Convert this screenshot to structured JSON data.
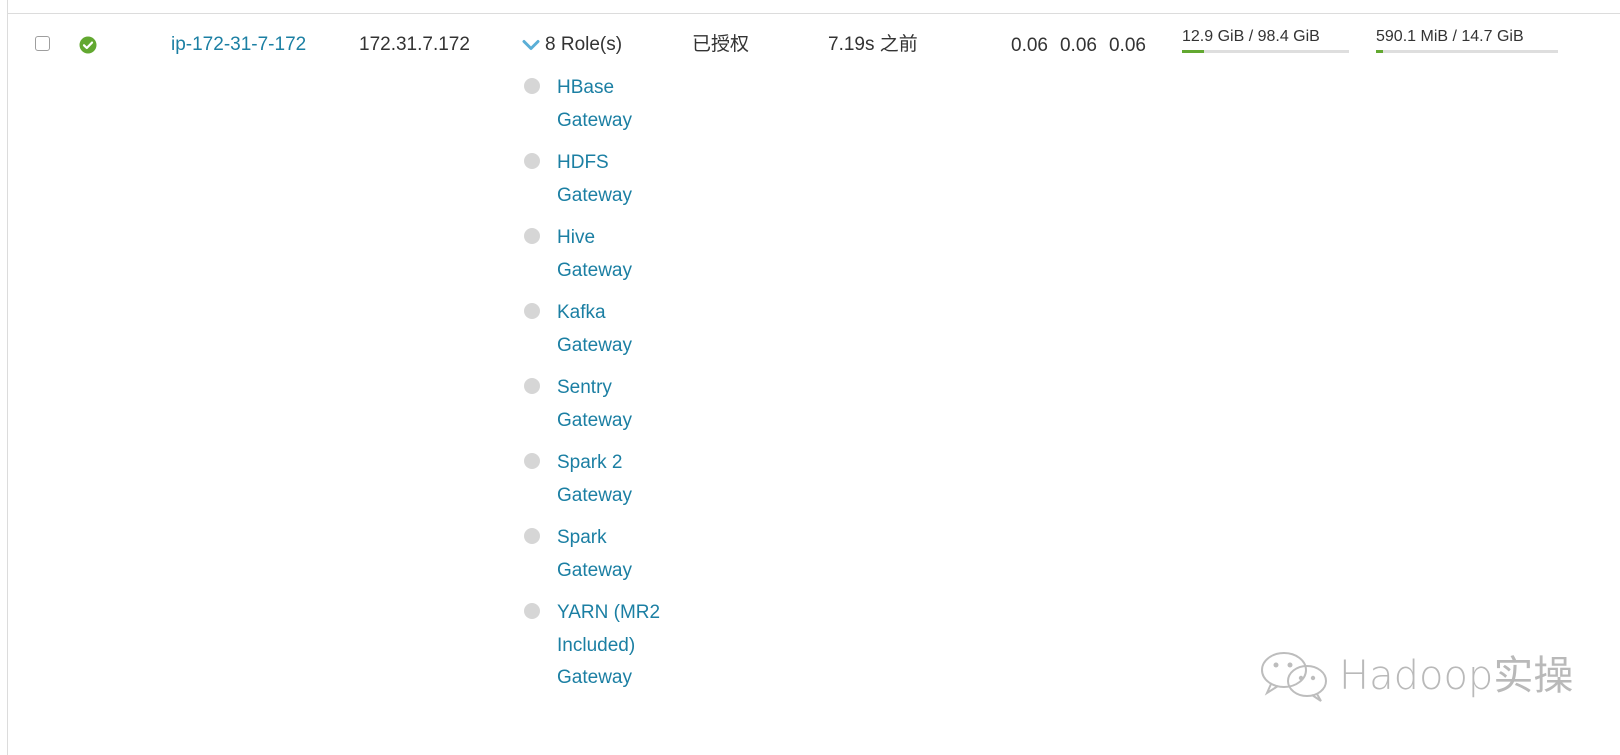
{
  "host_row": {
    "hostname": "ip-172-31-7-172",
    "ip_address": "172.31.7.172",
    "roles_toggle_label": "8 Role(s)",
    "commission_state": "已授权",
    "last_heartbeat": "7.19s 之前",
    "load_average": [
      "0.06",
      "0.06",
      "0.06"
    ],
    "disk_usage": {
      "label": "12.9 GiB / 98.4 GiB",
      "fraction": 0.131
    },
    "swap_usage": {
      "label": "590.1 MiB / 14.7 GiB",
      "fraction": 0.039
    },
    "roles": [
      {
        "label": "HBase Gateway"
      },
      {
        "label": "HDFS Gateway"
      },
      {
        "label": "Hive Gateway"
      },
      {
        "label": "Kafka Gateway"
      },
      {
        "label": "Sentry Gateway"
      },
      {
        "label": "Spark 2 Gateway"
      },
      {
        "label": "Spark Gateway"
      },
      {
        "label": "YARN (MR2 Included) Gateway"
      }
    ]
  },
  "watermark": {
    "text": "Hadoop实操"
  },
  "colors": {
    "link": "#1b7fa3",
    "status_ok": "#62a830",
    "role_dot_inactive": "#d6d6d6",
    "meter_fill": "#62a830",
    "watermark": "#b9b9b9"
  },
  "icons": {
    "status": "check-circle-icon",
    "roles_toggle": "chevron-down-icon",
    "watermark_logo": "wechat-icon"
  }
}
